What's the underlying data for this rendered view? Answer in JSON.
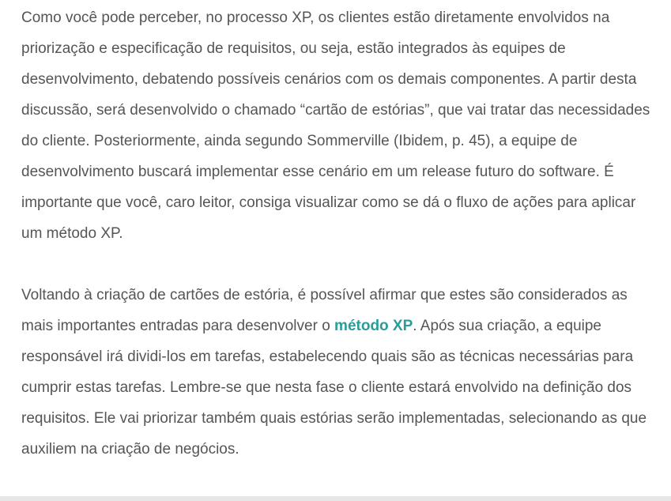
{
  "article": {
    "paragraph1": "Como você pode perceber, no processo XP, os clientes estão diretamente envolvidos na priorização e especificação de requisitos, ou seja, estão integrados às equipes de desenvolvimento, debatendo possíveis cenários com os demais componentes. A partir desta discussão, será desenvolvido o chamado “cartão de estórias”, que vai tratar das necessidades do cliente. Posteriormente, ainda segundo Sommerville (Ibidem, p. 45), a equipe de desenvolvimento buscará implementar esse cenário em um release futuro do software. É importante que você, caro leitor, consiga visualizar como se dá o fluxo de ações para aplicar um método XP.",
    "paragraph2": {
      "before_link": "Voltando à criação de cartões de estória, é possível afirmar que estes são considerados as mais importantes entradas para desenvolver o ",
      "link_text": "método XP",
      "after_link": ". Após sua criação, a equipe responsável irá dividi-los em tarefas, estabelecendo quais são as técnicas necessárias para cumprir estas tarefas. Lembre-se que nesta fase o cliente estará envolvido na definição dos requisitos. Ele vai priorizar também quais estórias serão implementadas, selecionando as que auxiliem na criação de negócios."
    },
    "link_color": "#2a9d9a",
    "text_color": "#555555"
  }
}
